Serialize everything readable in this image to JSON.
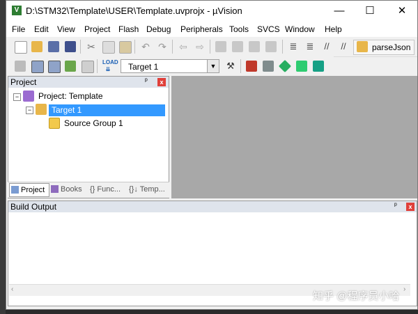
{
  "window": {
    "title": "D:\\STM32\\Template\\USER\\Template.uvprojx - µVision",
    "minimize": "—",
    "maximize": "☐",
    "close": "✕"
  },
  "menu": [
    "File",
    "Edit",
    "View",
    "Project",
    "Flash",
    "Debug",
    "Peripherals",
    "Tools",
    "SVCS",
    "Window",
    "Help"
  ],
  "toolbar": {
    "parse_label": "parseJson",
    "target_value": "Target 1"
  },
  "project_panel": {
    "title": "Project",
    "pin": "ᵖ",
    "close": "x",
    "tree": {
      "root": "Project: Template",
      "target": "Target 1",
      "group": "Source Group 1"
    },
    "tabs": [
      "Project",
      "Books",
      "{} Func...",
      "{}↓ Temp..."
    ]
  },
  "build_output": {
    "title": "Build Output",
    "close": "x"
  },
  "watermark": "知乎 @程序员小哈",
  "colors": {
    "selection": "#3399ff",
    "editor_bg": "#a8a8a8",
    "panel_close": "#e0403a"
  }
}
